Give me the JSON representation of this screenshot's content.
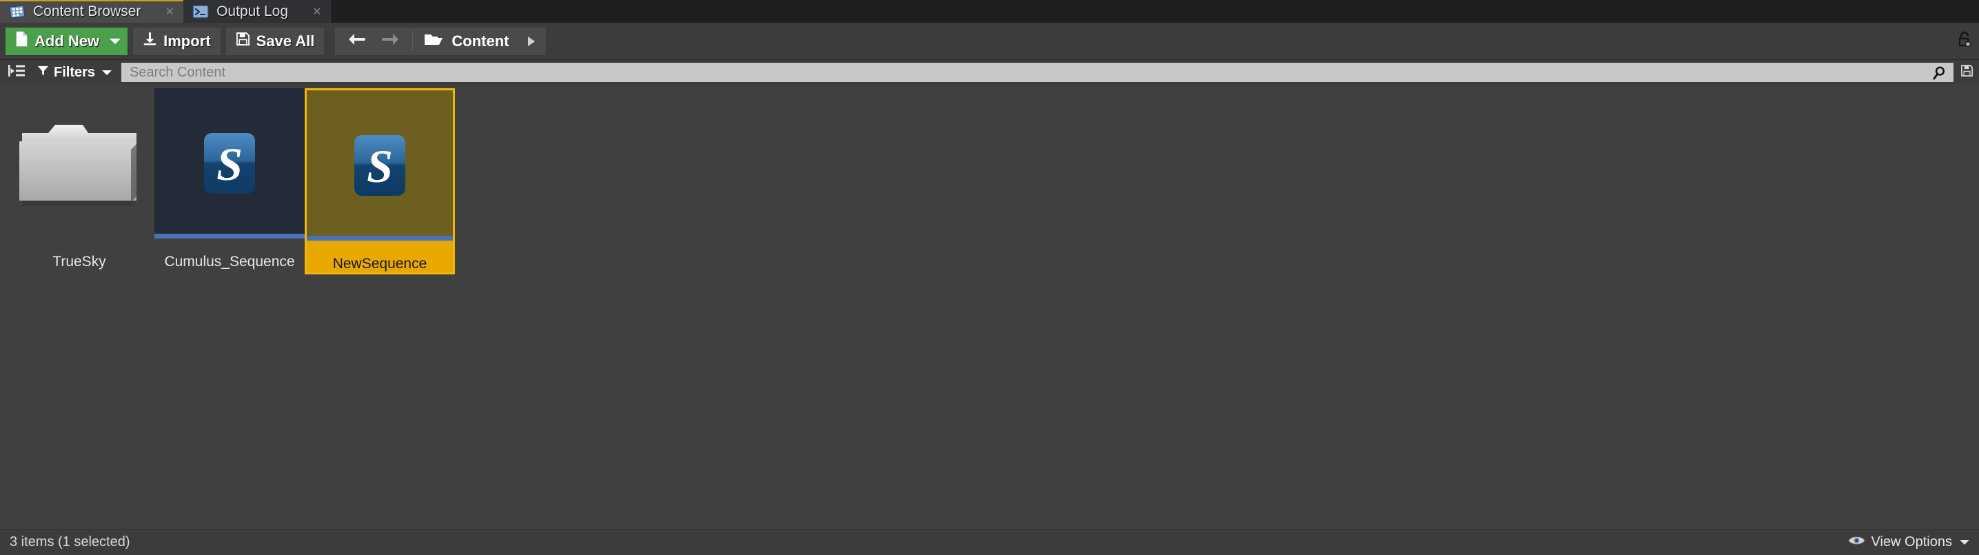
{
  "window": {
    "application": "Unreal Editor Content Browser"
  },
  "tabs": [
    {
      "label": "Content Browser",
      "icon": "content-browser-icon",
      "active": true,
      "close": "×"
    },
    {
      "label": "Output Log",
      "icon": "output-log-icon",
      "active": false,
      "close": "×"
    }
  ],
  "toolbar": {
    "add_new_label": "Add New",
    "add_new_icon": "new-document-icon",
    "import_label": "Import",
    "import_icon": "import-download-icon",
    "save_all_label": "Save All",
    "save_all_icon": "floppy-disk-icon",
    "back_icon": "arrow-left-icon",
    "forward_icon": "arrow-right-icon",
    "path_icon": "open-folder-icon",
    "path_label": "Content",
    "path_chevron_icon": "chevron-right-icon",
    "lock_icon": "unlocked-padlock-icon"
  },
  "filterbar": {
    "view_toggle_icon": "source-tree-toggle-icon",
    "filters_label": "Filters",
    "filters_icon": "funnel-icon",
    "search_value": "",
    "search_placeholder": "Search Content",
    "search_icon": "magnifier-icon",
    "save_search_icon": "save-search-icon"
  },
  "assets": [
    {
      "name": "TrueSky",
      "kind": "folder",
      "icon": "folder-icon",
      "selected": false,
      "type_color": ""
    },
    {
      "name": "Cumulus_Sequence",
      "kind": "asset",
      "icon": "sequence-s-icon",
      "selected": false,
      "type_color": "#4a72b8"
    },
    {
      "name": "NewSequence",
      "kind": "asset",
      "icon": "sequence-s-icon",
      "selected": true,
      "type_color": "#4a72b8"
    }
  ],
  "statusbar": {
    "items_text": "3 items (1 selected)",
    "view_options_label": "View Options",
    "view_options_icon": "eye-icon"
  },
  "colors": {
    "selection_amber": "#e8a800",
    "selection_border": "#f2b705",
    "add_new_green": "#4ba04b",
    "tab_active_accent": "#c8a020",
    "asset_thumb_bg": "#232a38",
    "type_bar_blue": "#4a72b8",
    "panel_bg": "#404040",
    "chrome_bg": "#3c3c3c"
  }
}
